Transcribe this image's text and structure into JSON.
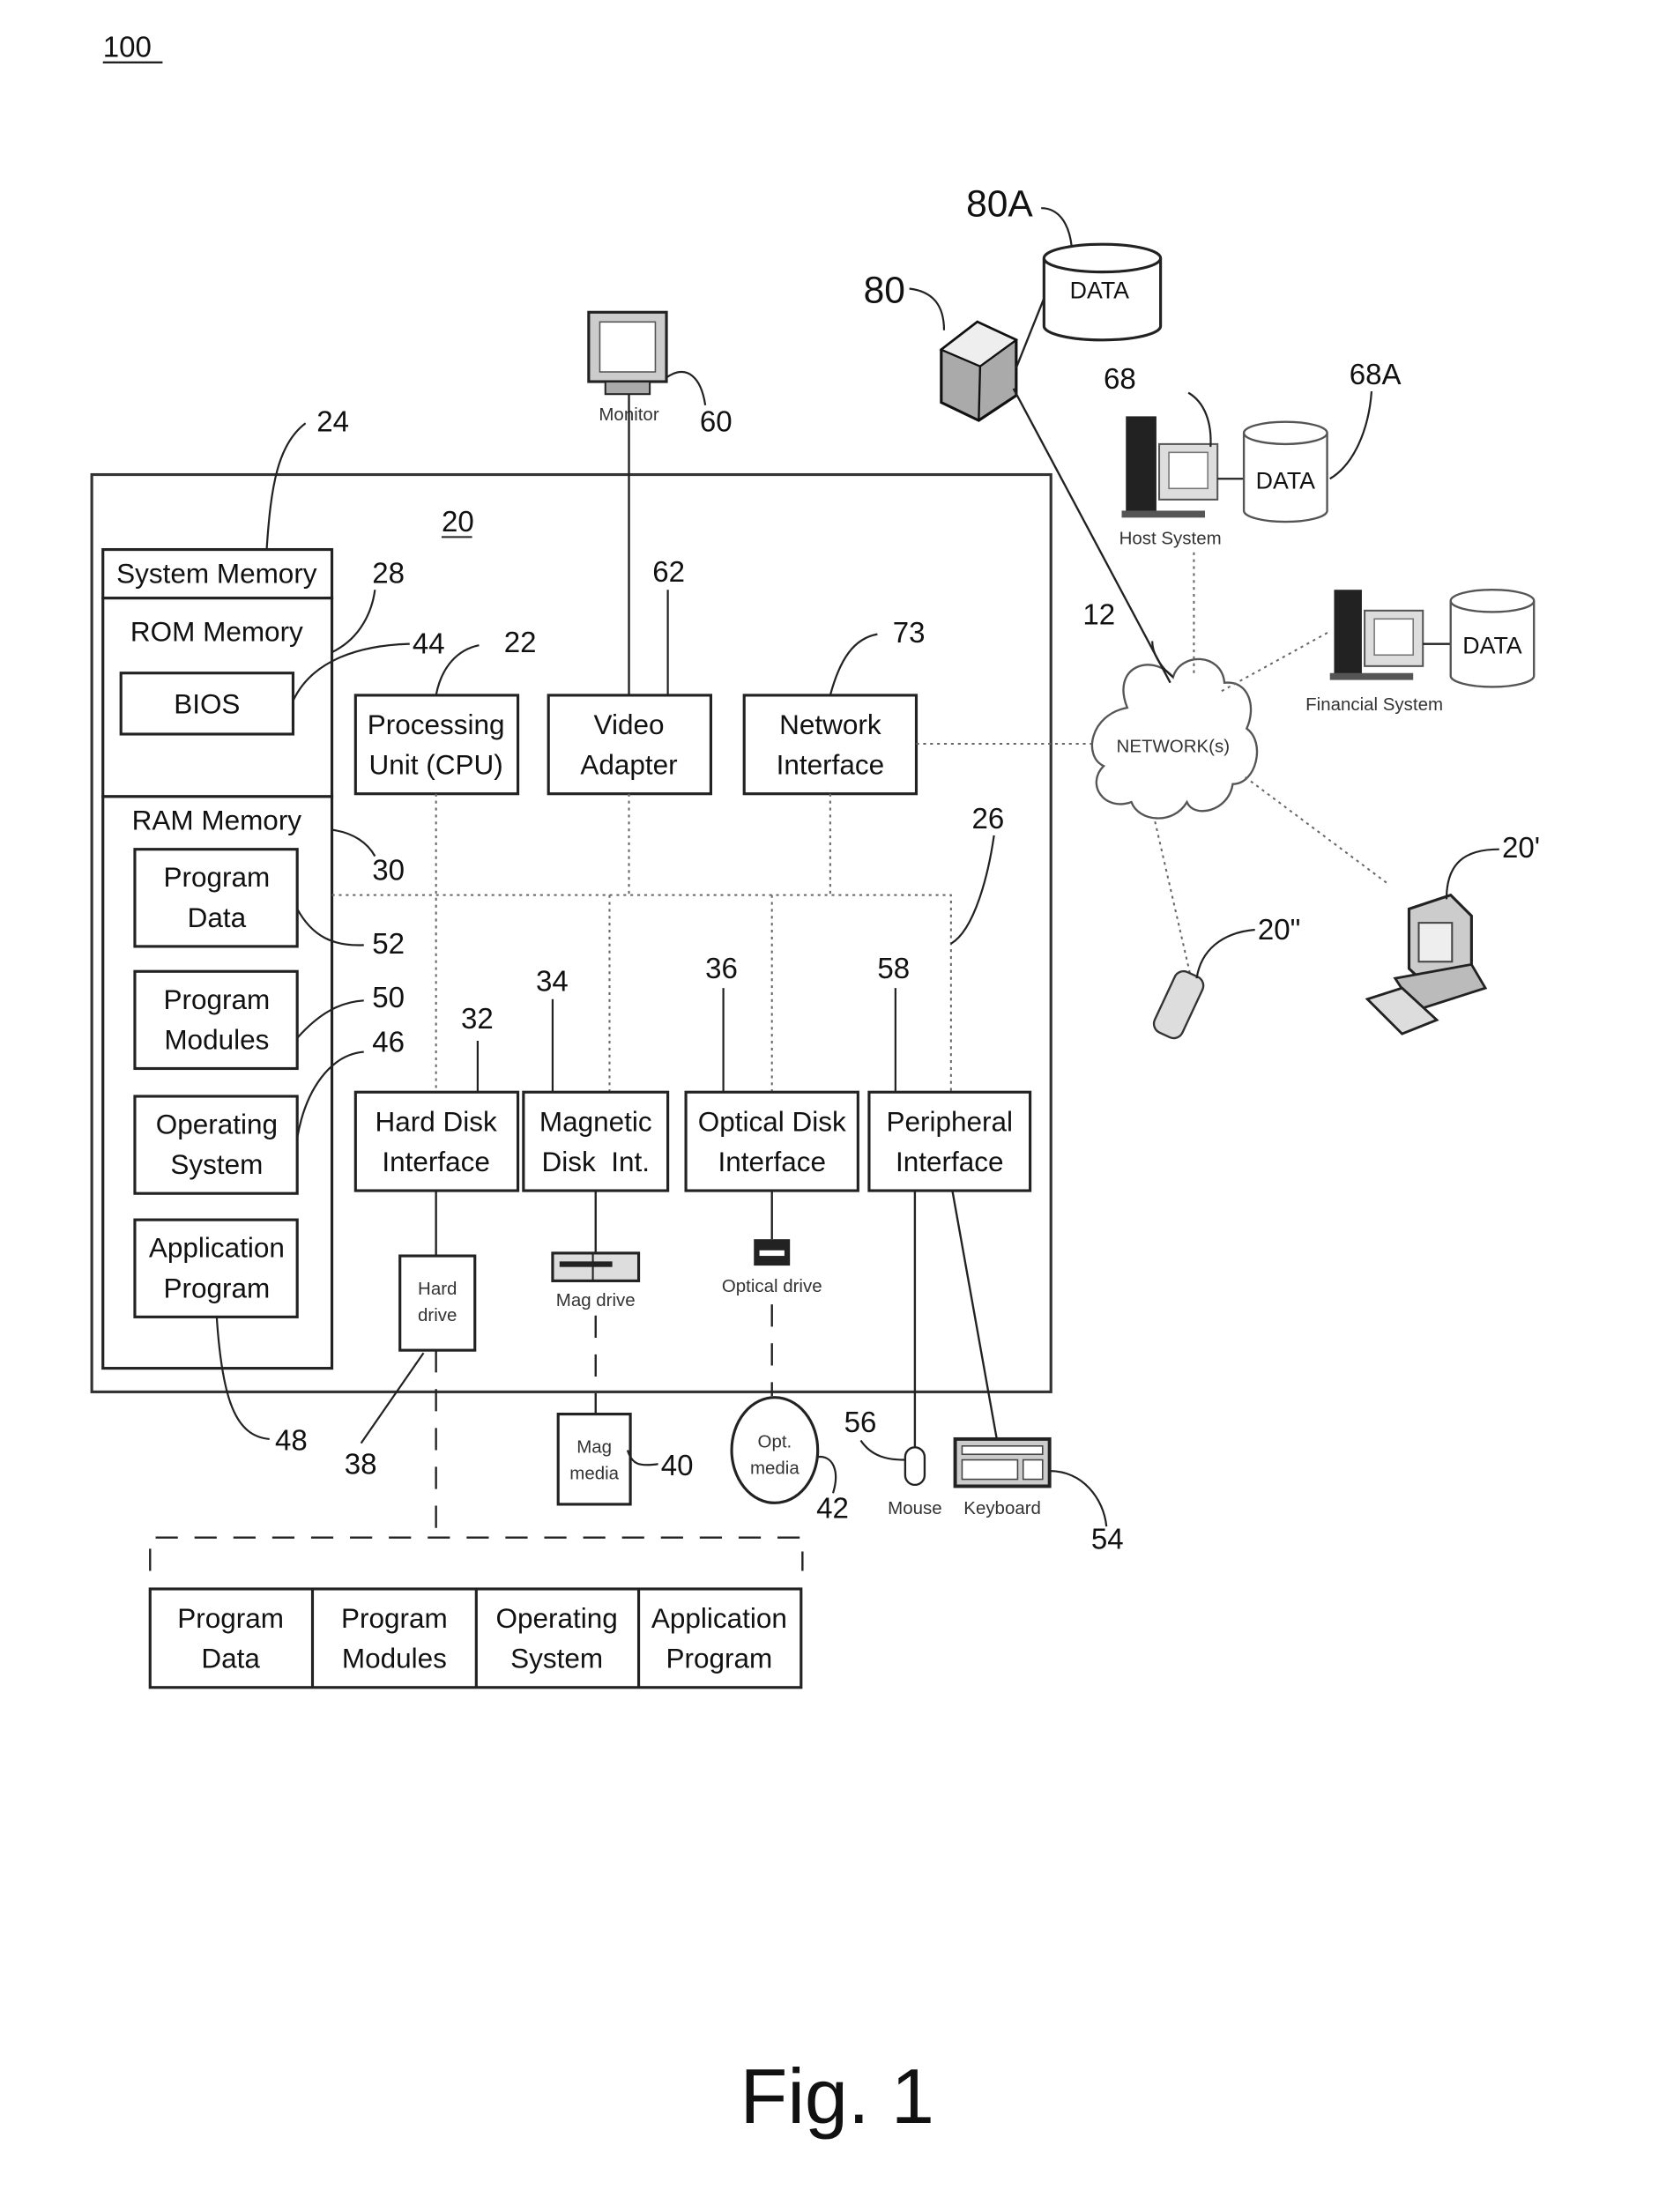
{
  "figure": {
    "number_label": "100",
    "caption": "Fig. 1",
    "computer_label": "20"
  },
  "system_memory": {
    "title": "System Memory",
    "rom_title": "ROM Memory",
    "bios": "BIOS",
    "ram_title": "RAM Memory",
    "ram_items": [
      {
        "line1": "Program",
        "line2": "Data"
      },
      {
        "line1": "Program",
        "line2": "Modules"
      },
      {
        "line1": "Operating",
        "line2": "System"
      },
      {
        "line1": "Application",
        "line2": "Program"
      }
    ]
  },
  "components": {
    "cpu": {
      "line1": "Processing",
      "line2": "Unit (CPU)"
    },
    "video": {
      "line1": "Video",
      "line2": "Adapter"
    },
    "network_if": {
      "line1": "Network",
      "line2": "Interface"
    },
    "hdd_if": {
      "line1": "Hard Disk",
      "line2": "Interface"
    },
    "mag_if": {
      "line1": "Magnetic",
      "line2": "Disk  Int."
    },
    "opt_if": {
      "line1": "Optical Disk",
      "line2": "Interface"
    },
    "periph_if": {
      "line1": "Peripheral",
      "line2": "Interface"
    }
  },
  "devices": {
    "monitor": "Monitor",
    "hard_drive": {
      "line1": "Hard",
      "line2": "drive"
    },
    "mag_drive": "Mag drive",
    "optical_drive": "Optical drive",
    "mag_media": {
      "line1": "Mag",
      "line2": "media"
    },
    "opt_media": {
      "line1": "Opt.",
      "line2": "media"
    },
    "mouse": "Mouse",
    "keyboard": "Keyboard"
  },
  "network": {
    "cloud": "NETWORK(s)",
    "host_system": "Host System",
    "financial_system": "Financial System",
    "data_label": "DATA"
  },
  "storage_table": [
    "Program Data",
    "Program Modules",
    "Operating System",
    "Application Program"
  ],
  "storage_table_lines": [
    {
      "line1": "Program",
      "line2": "Data"
    },
    {
      "line1": "Program",
      "line2": "Modules"
    },
    {
      "line1": "Operating",
      "line2": "System"
    },
    {
      "line1": "Application",
      "line2": "Program"
    }
  ],
  "reference_numerals": {
    "r24": "24",
    "r28": "28",
    "r44": "44",
    "r22": "22",
    "r62": "62",
    "r60": "60",
    "r73": "73",
    "r30": "30",
    "r26": "26",
    "r52": "52",
    "r50": "50",
    "r46": "46",
    "r32": "32",
    "r34": "34",
    "r36": "36",
    "r58": "58",
    "r48": "48",
    "r38": "38",
    "r40": "40",
    "r42": "42",
    "r56": "56",
    "r54": "54",
    "r12": "12",
    "r80": "80",
    "r80a": "80A",
    "r68": "68",
    "r68a": "68A",
    "r20p": "20'",
    "r20pp": "20\""
  }
}
